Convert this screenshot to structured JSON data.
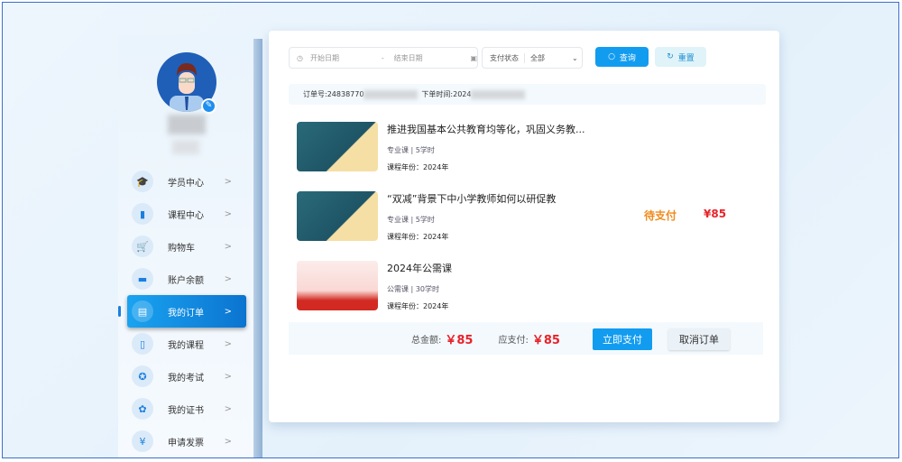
{
  "sidebar": {
    "items": [
      {
        "label": "学员中心",
        "icon": "graduation-cap-icon",
        "glyph": "🎓"
      },
      {
        "label": "课程中心",
        "icon": "book-icon",
        "glyph": "▮"
      },
      {
        "label": "购物车",
        "icon": "cart-icon",
        "glyph": "🛒"
      },
      {
        "label": "账户余额",
        "icon": "wallet-icon",
        "glyph": "▬"
      },
      {
        "label": "我的订单",
        "icon": "document-icon",
        "glyph": "▤",
        "active": true
      },
      {
        "label": "我的课程",
        "icon": "open-book-icon",
        "glyph": "▯"
      },
      {
        "label": "我的考试",
        "icon": "exam-icon",
        "glyph": "✪"
      },
      {
        "label": "我的证书",
        "icon": "certificate-icon",
        "glyph": "✿"
      },
      {
        "label": "申请发票",
        "icon": "invoice-icon",
        "glyph": "¥"
      }
    ],
    "chevron": ">"
  },
  "filters": {
    "start_placeholder": "开始日期",
    "separator": "-",
    "end_placeholder": "结束日期",
    "status_label": "支付状态",
    "status_value": "全部",
    "search_label": "查询",
    "reset_label": "重置"
  },
  "order": {
    "number_label": "订单号:",
    "number_visible": "24838770",
    "time_label": "下单时间:",
    "time_visible": "2024",
    "status": "待支付",
    "price": "¥85",
    "courses": [
      {
        "title": "推进我国基本公共教育均等化，巩固义务教...",
        "meta": "专业课 | 5学时",
        "year": "课程年份：2024年"
      },
      {
        "title": "“双减”背景下中小学教师如何以研促教",
        "meta": "专业课 | 5学时",
        "year": "课程年份：2024年"
      },
      {
        "title": "2024年公需课",
        "meta": "公需课 | 30学时",
        "year": "课程年份：2024年"
      }
    ],
    "total_label": "总金额:",
    "total": "￥85",
    "payable_label": "应支付:",
    "payable": "￥85",
    "pay_button": "立即支付",
    "cancel_button": "取消订单"
  },
  "colors": {
    "accent": "#129cf0",
    "status": "#f08a1c",
    "price": "#e8222a"
  }
}
